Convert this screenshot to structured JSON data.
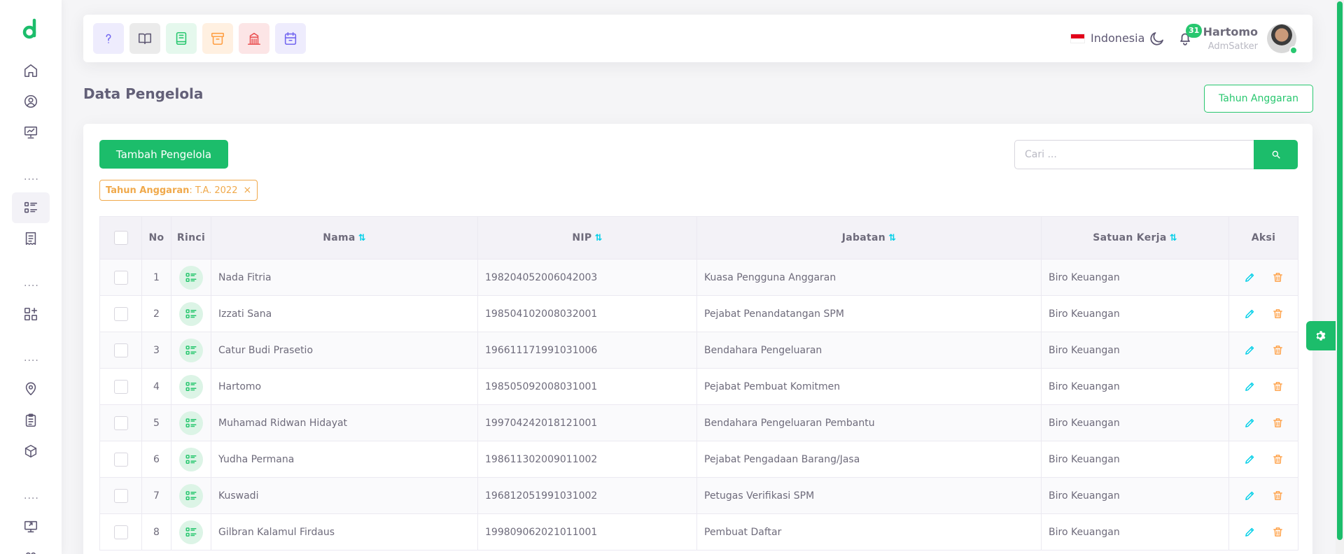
{
  "sidebar": {
    "logo": "d",
    "dots": "...."
  },
  "navbar": {
    "language": "Indonesia",
    "notification_count": "31",
    "user_name": "Hartomo",
    "user_role": "AdmSatker"
  },
  "page": {
    "title": "Data Pengelola",
    "fiscal_year_button": "Tahun Anggaran"
  },
  "toolbar": {
    "add_button": "Tambah Pengelola",
    "search_placeholder": "Cari ...",
    "filter_key": "Tahun Anggaran",
    "filter_value": ": T.A. 2022",
    "filter_remove": "×"
  },
  "table": {
    "headers": {
      "no": "No",
      "rinci": "Rinci",
      "nama": "Nama",
      "nip": "NIP",
      "jabatan": "Jabatan",
      "satuan_kerja": "Satuan Kerja",
      "aksi": "Aksi"
    },
    "sort_glyph": "⇅",
    "rows": [
      {
        "no": "1",
        "nama": "Nada Fitria",
        "nip": "198204052006042003",
        "jabatan": "Kuasa Pengguna Anggaran",
        "satker": "Biro Keuangan"
      },
      {
        "no": "2",
        "nama": "Izzati Sana",
        "nip": "198504102008032001",
        "jabatan": "Pejabat Penandatangan SPM",
        "satker": "Biro Keuangan"
      },
      {
        "no": "3",
        "nama": "Catur Budi Prasetio",
        "nip": "196611171991031006",
        "jabatan": "Bendahara Pengeluaran",
        "satker": "Biro Keuangan"
      },
      {
        "no": "4",
        "nama": "Hartomo",
        "nip": "198505092008031001",
        "jabatan": "Pejabat Pembuat Komitmen",
        "satker": "Biro Keuangan"
      },
      {
        "no": "5",
        "nama": "Muhamad Ridwan Hidayat",
        "nip": "199704242018121001",
        "jabatan": "Bendahara Pengeluaran Pembantu",
        "satker": "Biro Keuangan"
      },
      {
        "no": "6",
        "nama": "Yudha Permana",
        "nip": "198611302009011002",
        "jabatan": "Pejabat Pengadaan Barang/Jasa",
        "satker": "Biro Keuangan"
      },
      {
        "no": "7",
        "nama": "Kuswadi",
        "nip": "196812051991031002",
        "jabatan": "Petugas Verifikasi SPM",
        "satker": "Biro Keuangan"
      },
      {
        "no": "8",
        "nama": "Gilbran Kalamul Firdaus",
        "nip": "199809062021011001",
        "jabatan": "Pembuat Daftar",
        "satker": "Biro Keuangan"
      }
    ]
  },
  "colors": {
    "primary": "#1cbd6b",
    "warning": "#ff9f43",
    "info": "#00cfe8"
  }
}
